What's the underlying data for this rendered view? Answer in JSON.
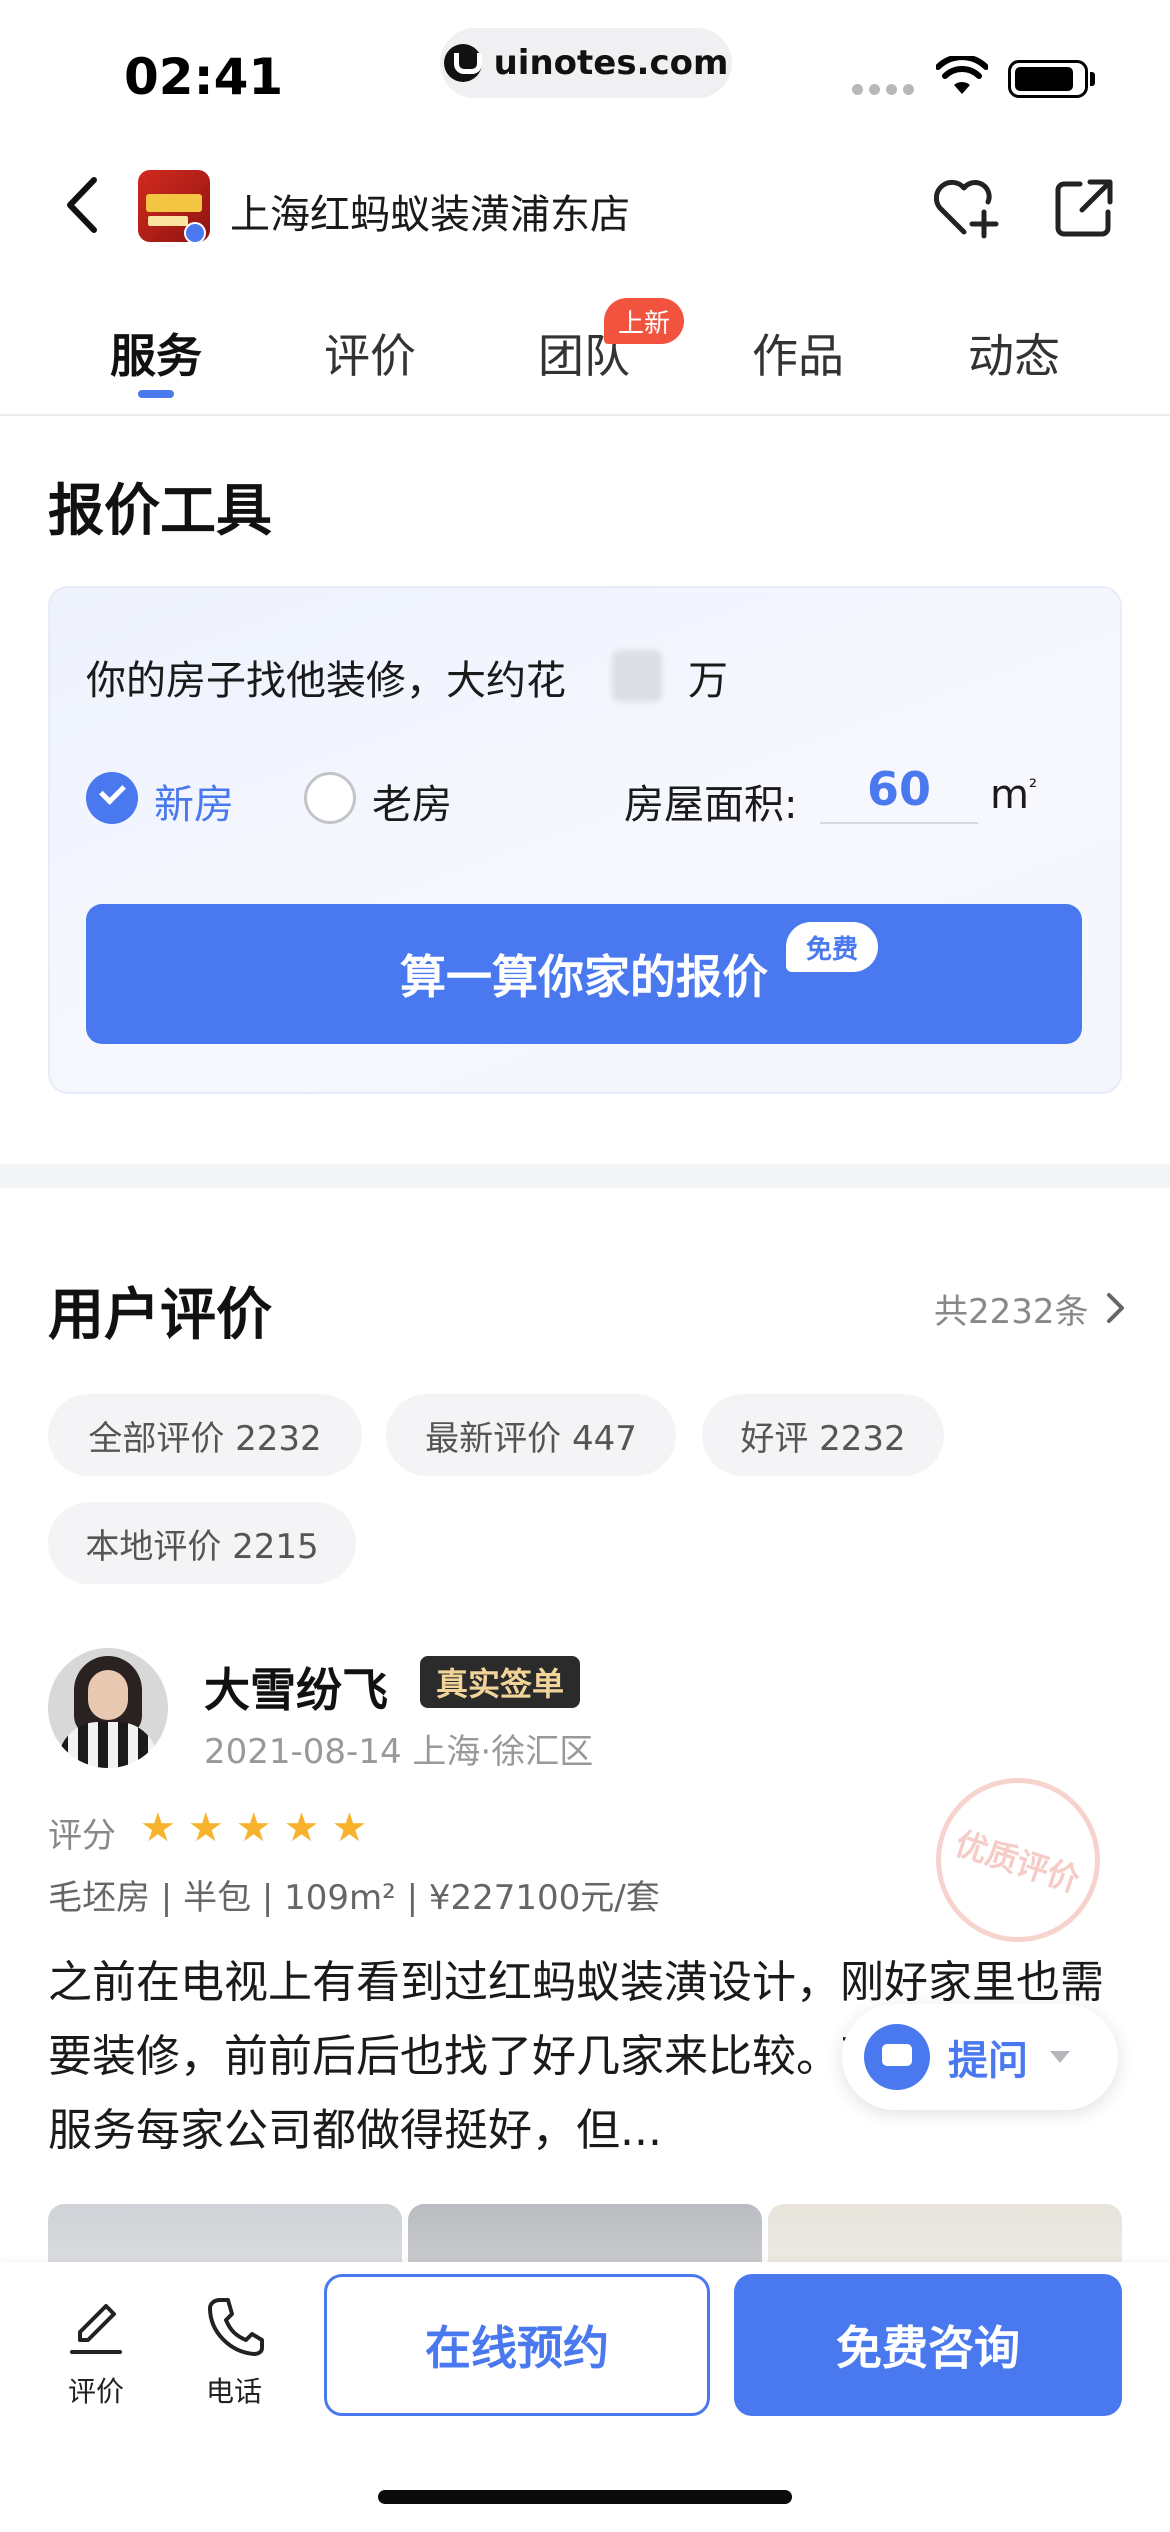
{
  "status_bar": {
    "time": "02:41",
    "url": "uinotes.com"
  },
  "header": {
    "shop_name": "上海红蚂蚁装潢浦东店"
  },
  "tabs": [
    {
      "label": "服务",
      "active": true
    },
    {
      "label": "评价"
    },
    {
      "label": "团队",
      "badge": "上新"
    },
    {
      "label": "作品"
    },
    {
      "label": "动态"
    }
  ],
  "quote_tool": {
    "title": "报价工具",
    "question_prefix": "你的房子找他装修，大约花",
    "question_suffix": "万",
    "option_new": "新房",
    "option_old": "老房",
    "area_label": "房屋面积:",
    "area_value": "60",
    "area_unit": "m",
    "area_unit_sup": "²",
    "calc_button": "算一算你家的报价",
    "free_badge": "免费"
  },
  "reviews": {
    "title": "用户评价",
    "total_link": "共2232条",
    "filters": [
      "全部评价 2232",
      "最新评价 447",
      "好评 2232",
      "本地评价 2215"
    ],
    "item": {
      "user_name": "大雪纷飞",
      "verified_badge": "真实签单",
      "meta": "2021-08-14 上海·徐汇区",
      "score_label": "评分",
      "stars": 5,
      "house_info": "毛坯房 | 半包 | 109m² | ¥227100元/套",
      "body": "之前在电视上有看到过红蚂蚁装潢设计，刚好家里也需要装修，前前后后也找了好几家来比较。不用说前期的服务每家公司都做得挺好，但...",
      "stamp": "优质评价"
    }
  },
  "ask_float": {
    "label": "提问"
  },
  "bottom_bar": {
    "review_label": "评价",
    "phone_label": "电话",
    "book_button": "在线预约",
    "consult_button": "免费咨询"
  },
  "colors": {
    "accent": "#4a78ef",
    "badge_red": "#f2533f",
    "star": "#f7b32b"
  }
}
